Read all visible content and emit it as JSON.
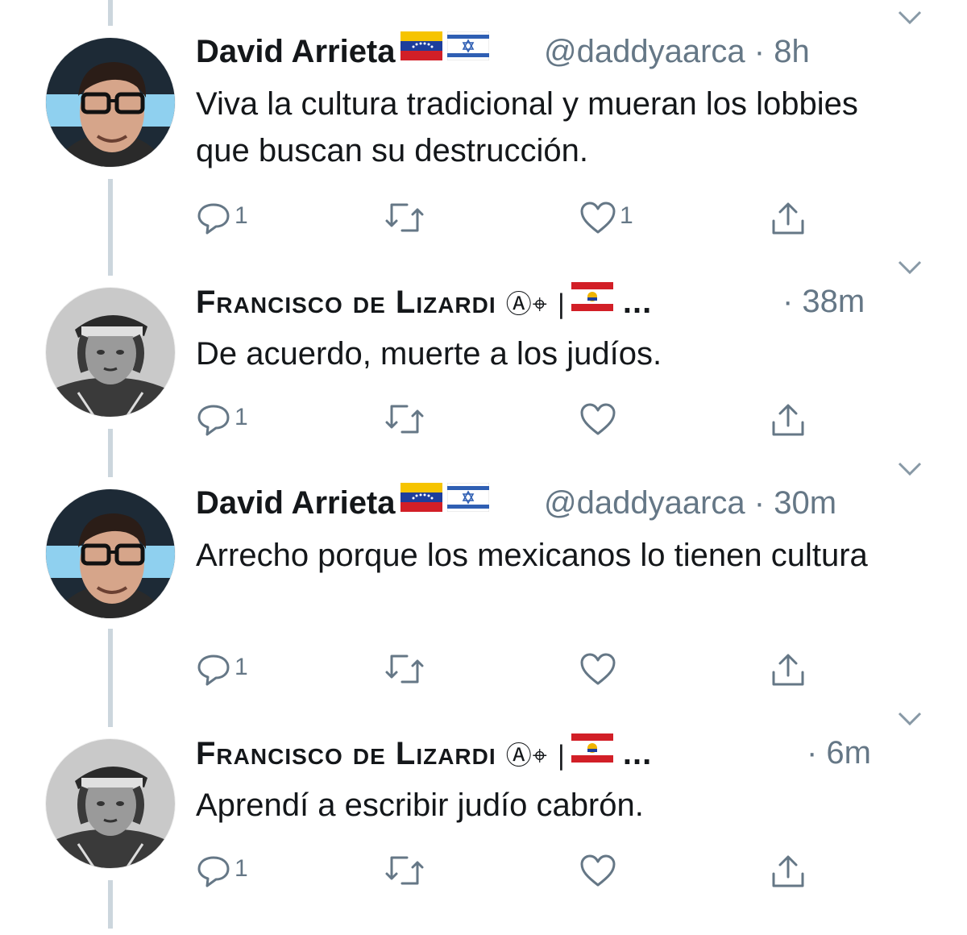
{
  "colors": {
    "text": "#14171a",
    "muted": "#657786",
    "thread_line": "#ccd6dd"
  },
  "tweets": [
    {
      "name": "David Arrieta",
      "name_style": "bold",
      "flags": [
        "flag-venezuela",
        "flag-israel"
      ],
      "handle_time": "@daddyaarca · 8h",
      "text": "Viva la cultura tradicional y mueran los lobbies que buscan su destrucción.",
      "replies": "1",
      "retweets": "",
      "likes": "1"
    },
    {
      "name": "Francisco de Lizardi",
      "name_style": "small-caps",
      "symbols": "Ⓐ⌖ |",
      "flags": [
        "flag-french-polynesia"
      ],
      "ellipsis": "...",
      "handle_time": "· 38m",
      "text": "De acuerdo, muerte a los judíos.",
      "replies": "1",
      "retweets": "",
      "likes": ""
    },
    {
      "name": "David Arrieta",
      "name_style": "bold",
      "flags": [
        "flag-venezuela",
        "flag-israel"
      ],
      "handle_time": "@daddyaarca · 30m",
      "text": "Arrecho porque los mexicanos lo tienen cultura",
      "replies": "1",
      "retweets": "",
      "likes": ""
    },
    {
      "name": "Francisco de Lizardi",
      "name_style": "small-caps",
      "symbols": "Ⓐ⌖ |",
      "flags": [
        "flag-french-polynesia"
      ],
      "ellipsis": "...",
      "handle_time": "· 6m",
      "text": "Aprendí a escribir judío cabrón.",
      "replies": "1",
      "retweets": "",
      "likes": ""
    }
  ]
}
